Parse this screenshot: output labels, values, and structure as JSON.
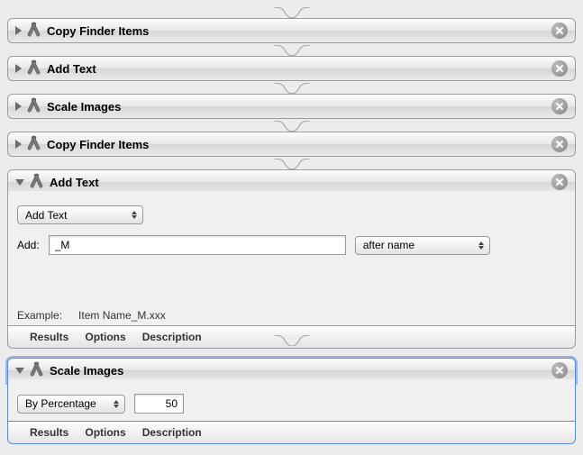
{
  "connector_color": "#9c9c9c",
  "actions": [
    {
      "title": "Copy Finder Items"
    },
    {
      "title": "Add Text"
    },
    {
      "title": "Scale Images"
    },
    {
      "title": "Copy Finder Items"
    }
  ],
  "addText": {
    "title": "Add Text",
    "mode_popup": "Add Text",
    "add_label": "Add:",
    "add_value": "_M",
    "position_popup": "after name",
    "example_label": "Example:",
    "example_value": "Item Name_M.xxx"
  },
  "scaleImages": {
    "title": "Scale Images",
    "mode_popup": "By Percentage",
    "value": "50"
  },
  "footer": {
    "results": "Results",
    "options": "Options",
    "description": "Description"
  }
}
